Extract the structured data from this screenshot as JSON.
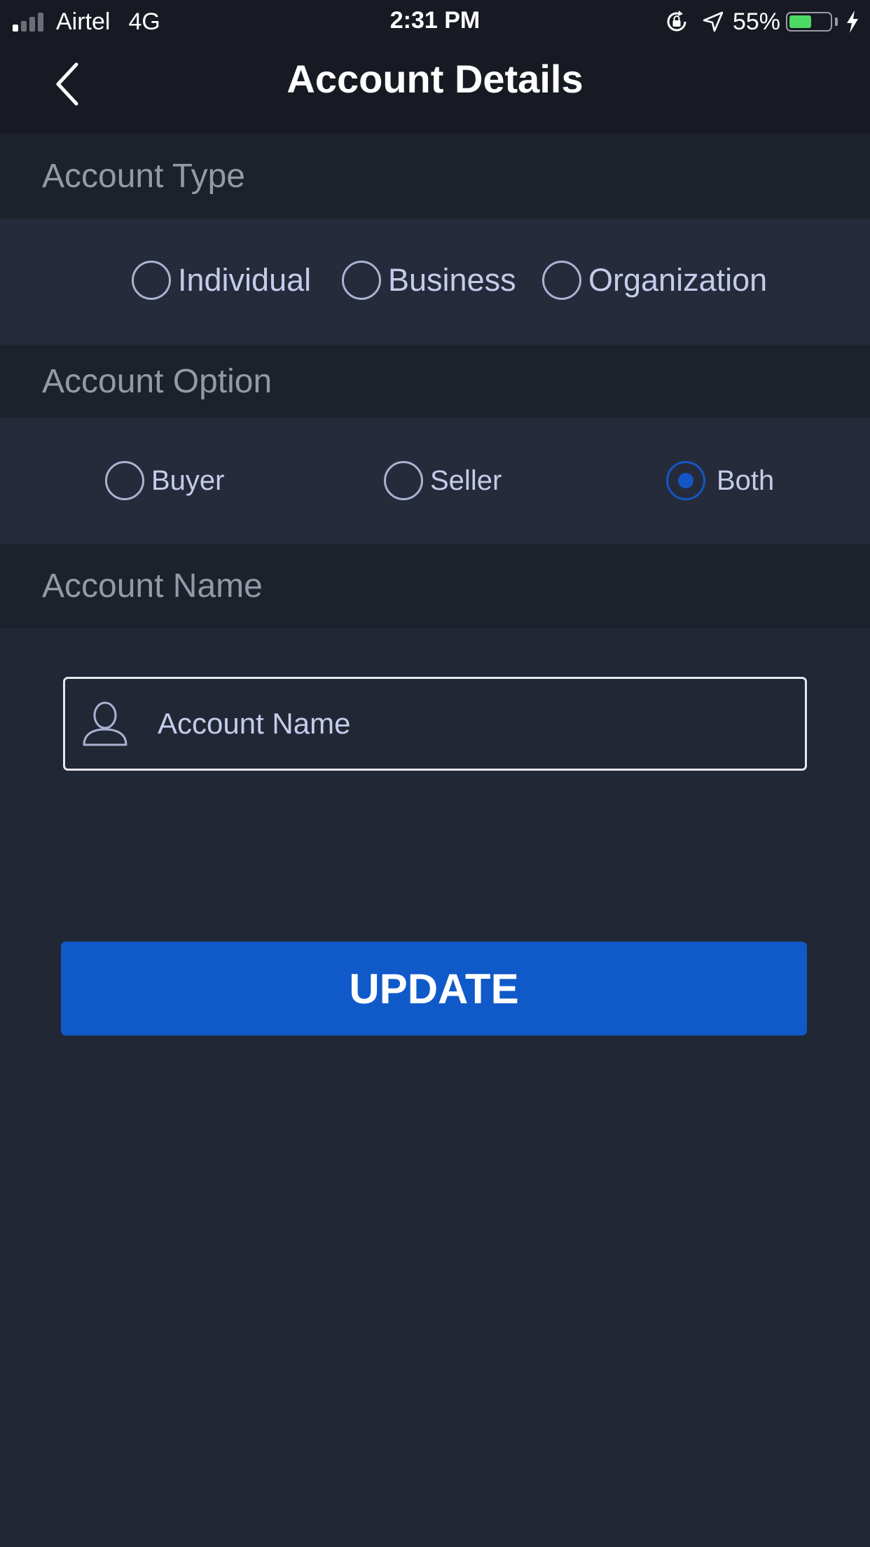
{
  "status_bar": {
    "carrier": "Airtel",
    "network": "4G",
    "time": "2:31 PM",
    "battery_percent_text": "55%",
    "battery_level": 0.55,
    "battery_color": "#4cd964"
  },
  "nav": {
    "title": "Account Details",
    "back_icon": "chevron-left-icon"
  },
  "account_type": {
    "heading": "Account Type",
    "options": [
      {
        "label": "Individual",
        "selected": false
      },
      {
        "label": "Business",
        "selected": false
      },
      {
        "label": "Organization",
        "selected": false
      }
    ]
  },
  "account_option": {
    "heading": "Account Option",
    "options": [
      {
        "label": "Buyer",
        "selected": false
      },
      {
        "label": "Seller",
        "selected": false
      },
      {
        "label": "Both",
        "selected": true
      }
    ]
  },
  "account_name": {
    "heading": "Account Name",
    "input_icon": "user-icon",
    "input_value": "",
    "input_placeholder": "Account Name"
  },
  "update_button": {
    "label": "UPDATE",
    "color": "#1059c8"
  },
  "colors": {
    "background": "#222736",
    "accent": "#1456c5",
    "radio_border": "#aab3d3"
  }
}
